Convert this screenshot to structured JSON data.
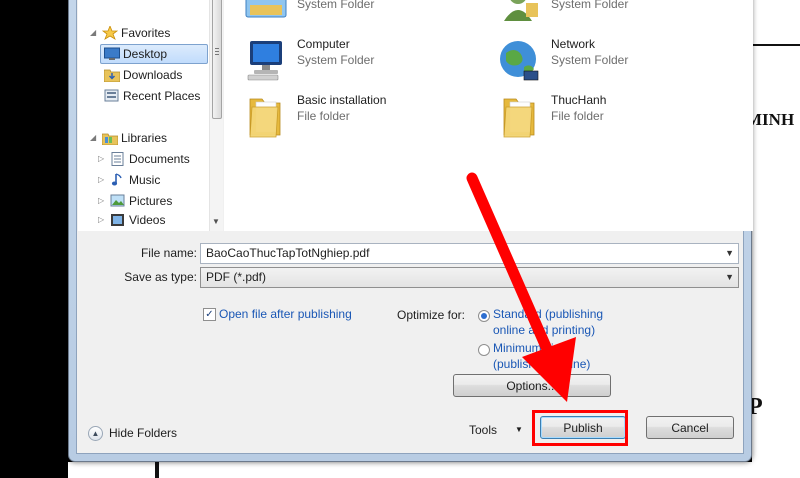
{
  "background_document": {
    "text_right_1": "MINH",
    "text_right_2": "P"
  },
  "nav_pane": {
    "items": [
      {
        "label": "Favorites",
        "icon": "star-icon",
        "expand": "expanded",
        "selected": false
      },
      {
        "label": "Desktop",
        "icon": "desktop-icon",
        "expand": "none",
        "selected": true
      },
      {
        "label": "Downloads",
        "icon": "downloads-folder-icon",
        "expand": "none",
        "selected": false
      },
      {
        "label": "Recent Places",
        "icon": "recent-places-icon",
        "expand": "none",
        "selected": false
      },
      {
        "label": "Libraries",
        "icon": "libraries-icon",
        "expand": "expanded",
        "selected": false
      },
      {
        "label": "Documents",
        "icon": "documents-icon",
        "expand": "collapsed",
        "selected": false
      },
      {
        "label": "Music",
        "icon": "music-icon",
        "expand": "collapsed",
        "selected": false
      },
      {
        "label": "Pictures",
        "icon": "pictures-icon",
        "expand": "collapsed",
        "selected": false
      },
      {
        "label": "Videos",
        "icon": "videos-icon",
        "expand": "collapsed",
        "selected": false
      }
    ]
  },
  "files": [
    {
      "name": "",
      "type": "System Folder",
      "icon": "libraries-folder-icon"
    },
    {
      "name": "",
      "type": "System Folder",
      "icon": "user-folder-icon"
    },
    {
      "name": "Computer",
      "type": "System Folder",
      "icon": "computer-icon"
    },
    {
      "name": "Network",
      "type": "System Folder",
      "icon": "network-icon"
    },
    {
      "name": "Basic installation",
      "type": "File folder",
      "icon": "folder-icon"
    },
    {
      "name": "ThucHanh",
      "type": "File folder",
      "icon": "folder-icon"
    }
  ],
  "form": {
    "file_name_label": "File name:",
    "file_name_value": "BaoCaoThucTapTotNghiep.pdf",
    "save_as_type_label": "Save as type:",
    "save_as_type_value": "PDF (*.pdf)",
    "open_after_publishing_label": "Open file after publishing",
    "open_after_publishing_checked": true,
    "optimize_for_label": "Optimize for:",
    "optimize_option_standard_line1": "Standard (publishing",
    "optimize_option_standard_line2": "online and printing)",
    "optimize_option_minimum_line1": "Minimum size",
    "optimize_option_minimum_line2": "(publishing online)",
    "selected_optimize": "standard",
    "options_button": "Options..."
  },
  "footer": {
    "hide_folders_label": "Hide Folders",
    "tools_label": "Tools",
    "publish_button": "Publish",
    "cancel_button": "Cancel"
  },
  "annotation": {
    "arrow_color": "#ff0000",
    "highlight_color": "#ff0000"
  }
}
